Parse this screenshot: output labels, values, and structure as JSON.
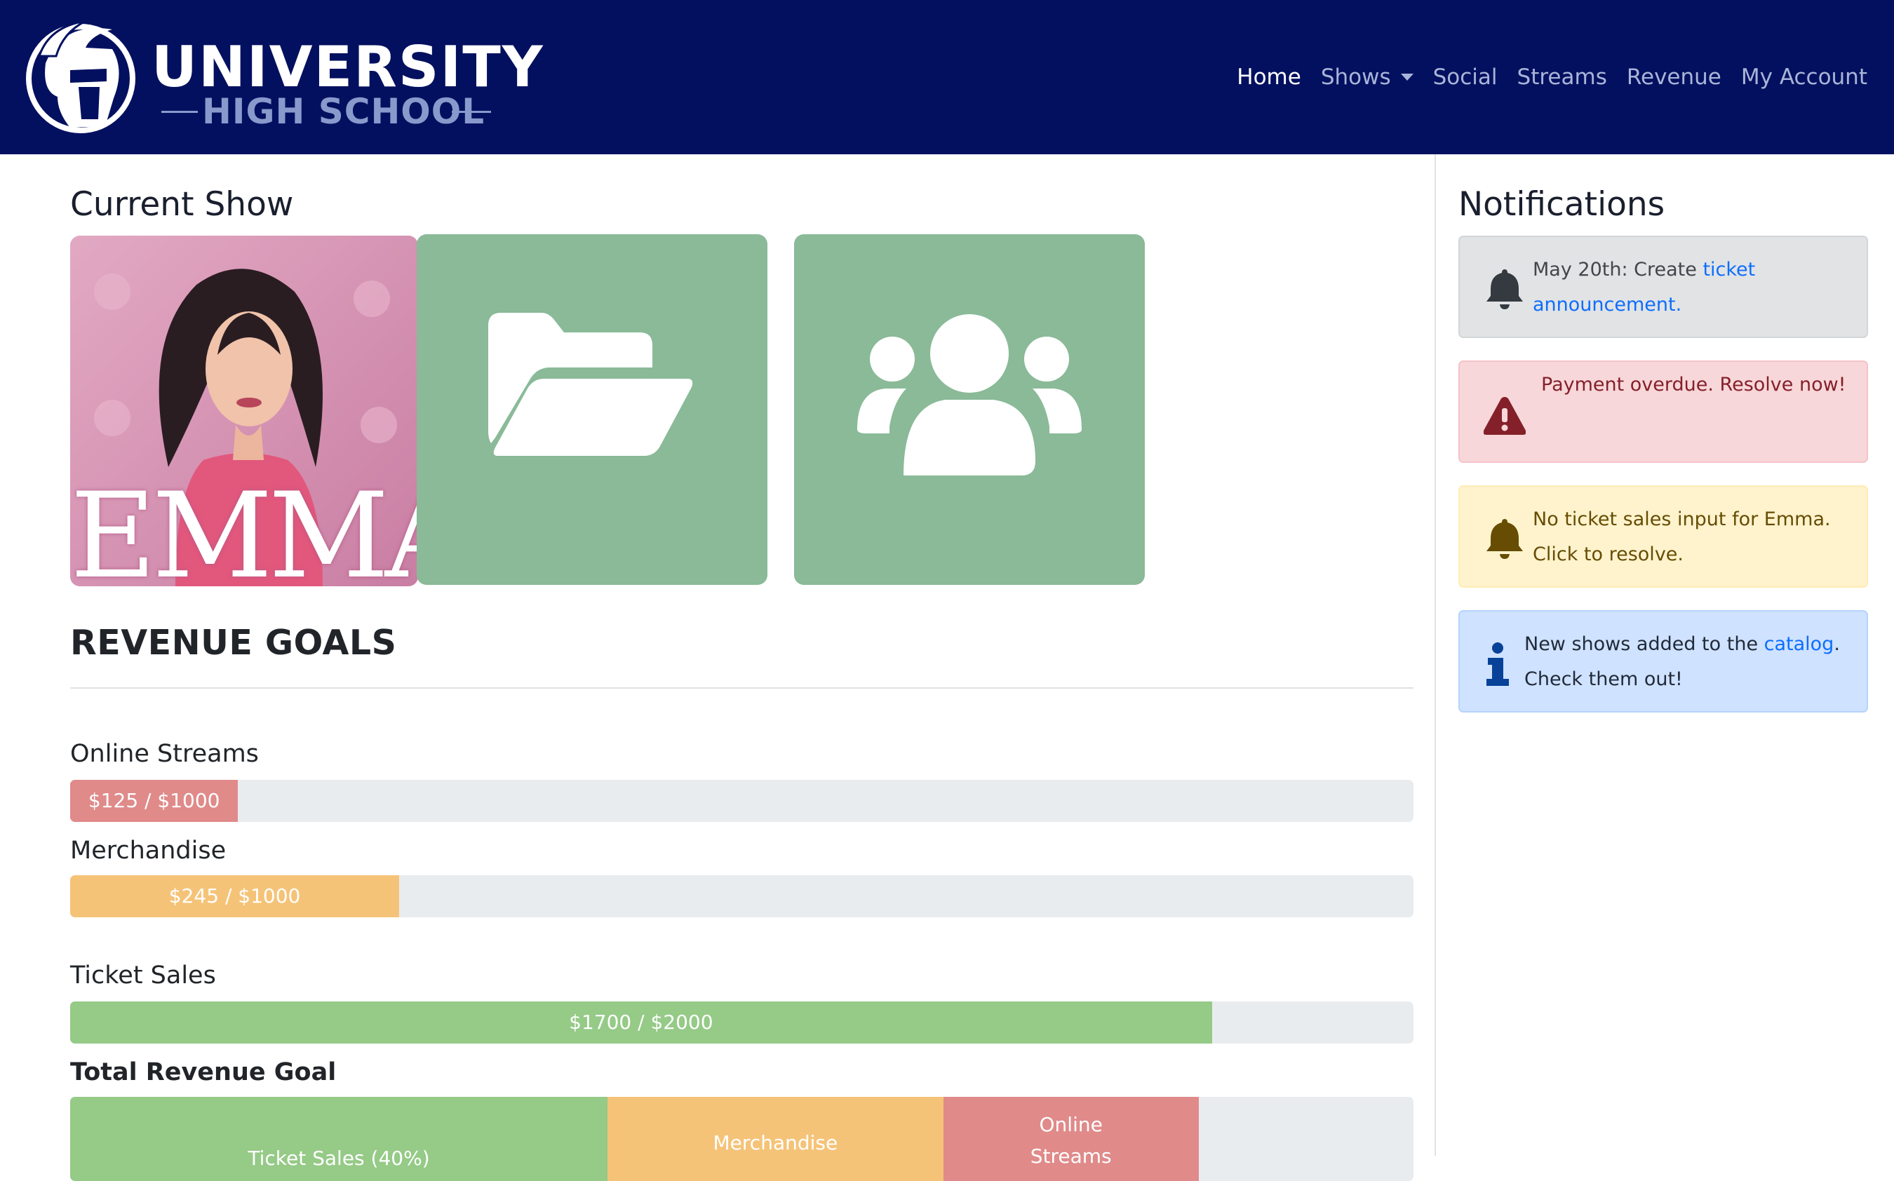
{
  "brand": {
    "line1": "UNIVERSITY",
    "line2": "HIGH SCHOOL"
  },
  "nav": {
    "items": [
      {
        "label": "Home",
        "active": true
      },
      {
        "label": "Shows",
        "dropdown": true
      },
      {
        "label": "Social"
      },
      {
        "label": "Streams"
      },
      {
        "label": "Revenue"
      },
      {
        "label": "My Account"
      }
    ]
  },
  "current_show": {
    "heading": "Current Show",
    "poster_title": "EMMA",
    "tiles": [
      {
        "icon": "folder-open-icon"
      },
      {
        "icon": "users-icon"
      }
    ],
    "tile_color": "#8aba98"
  },
  "revenue": {
    "heading": "REVENUE GOALS",
    "goals": [
      {
        "label": "Online Streams",
        "text": "$125 / $1000",
        "current": 125,
        "goal": 1000,
        "color": "#e08a8a"
      },
      {
        "label": "Merchandise",
        "text": "$245 / $1000",
        "current": 245,
        "goal": 1000,
        "color": "#f5c378"
      },
      {
        "label": "Ticket Sales",
        "text": "$1700 / $2000",
        "current": 1700,
        "goal": 2000,
        "color": "#95ca87"
      }
    ],
    "total": {
      "label": "Total Revenue Goal",
      "segments": [
        {
          "text": "Ticket Sales (40%)",
          "percent": 40,
          "color": "#95ca87"
        },
        {
          "text": "Merchandise",
          "percent": 25,
          "color": "#f5c378"
        },
        {
          "text": "Online Streams",
          "percent": 19,
          "color": "#e08a8a"
        }
      ]
    }
  },
  "notifications": {
    "heading": "Notifications",
    "items": [
      {
        "variant": "gray",
        "icon": "bell-icon",
        "text_before": "May 20th: Create ",
        "link": "ticket announcement.",
        "text_after": ""
      },
      {
        "variant": "red",
        "icon": "warning-triangle-icon",
        "text_before": "Payment overdue. Resolve now!",
        "link": "",
        "text_after": ""
      },
      {
        "variant": "yellow",
        "icon": "bell-icon",
        "text_before": "No ticket sales input for Emma. Click to resolve.",
        "link": "",
        "text_after": ""
      },
      {
        "variant": "blue",
        "icon": "info-icon",
        "text_before": "New shows added to the ",
        "link": "catalog",
        "text_after": ". Check them out!"
      }
    ]
  }
}
